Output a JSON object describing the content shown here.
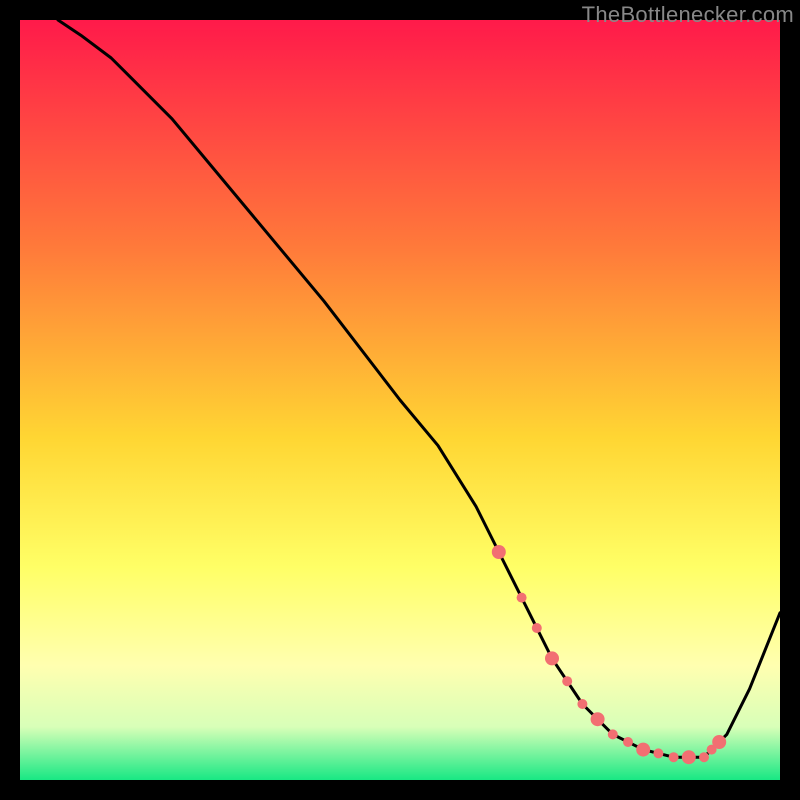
{
  "watermark": "TheBottlenecker.com",
  "colors": {
    "black": "#000000",
    "line": "#000000",
    "dot": "#f26f72",
    "grad_top": "#ff1a4a",
    "grad_mid1": "#ff7a3a",
    "grad_mid2": "#ffd633",
    "grad_mid3": "#ffff66",
    "grad_mid4": "#ffffb0",
    "grad_mid5": "#d8ffb8",
    "grad_bottom": "#18e884"
  },
  "chart_data": {
    "type": "line",
    "title": "",
    "xlabel": "",
    "ylabel": "",
    "xlim": [
      0,
      100
    ],
    "ylim": [
      0,
      100
    ],
    "series": [
      {
        "name": "curve",
        "x": [
          5,
          8,
          12,
          20,
          30,
          40,
          50,
          55,
          60,
          63,
          66,
          70,
          74,
          78,
          82,
          86,
          90,
          93,
          96,
          100
        ],
        "y": [
          100,
          98,
          95,
          87,
          75,
          63,
          50,
          44,
          36,
          30,
          24,
          16,
          10,
          6,
          4,
          3,
          3,
          6,
          12,
          22
        ]
      }
    ],
    "dots": {
      "x": [
        63,
        66,
        68,
        70,
        72,
        74,
        76,
        78,
        80,
        82,
        84,
        86,
        88,
        90,
        91,
        92
      ],
      "y": [
        30,
        24,
        20,
        16,
        13,
        10,
        8,
        6,
        5,
        4,
        3.5,
        3,
        3,
        3,
        4,
        5
      ]
    }
  }
}
